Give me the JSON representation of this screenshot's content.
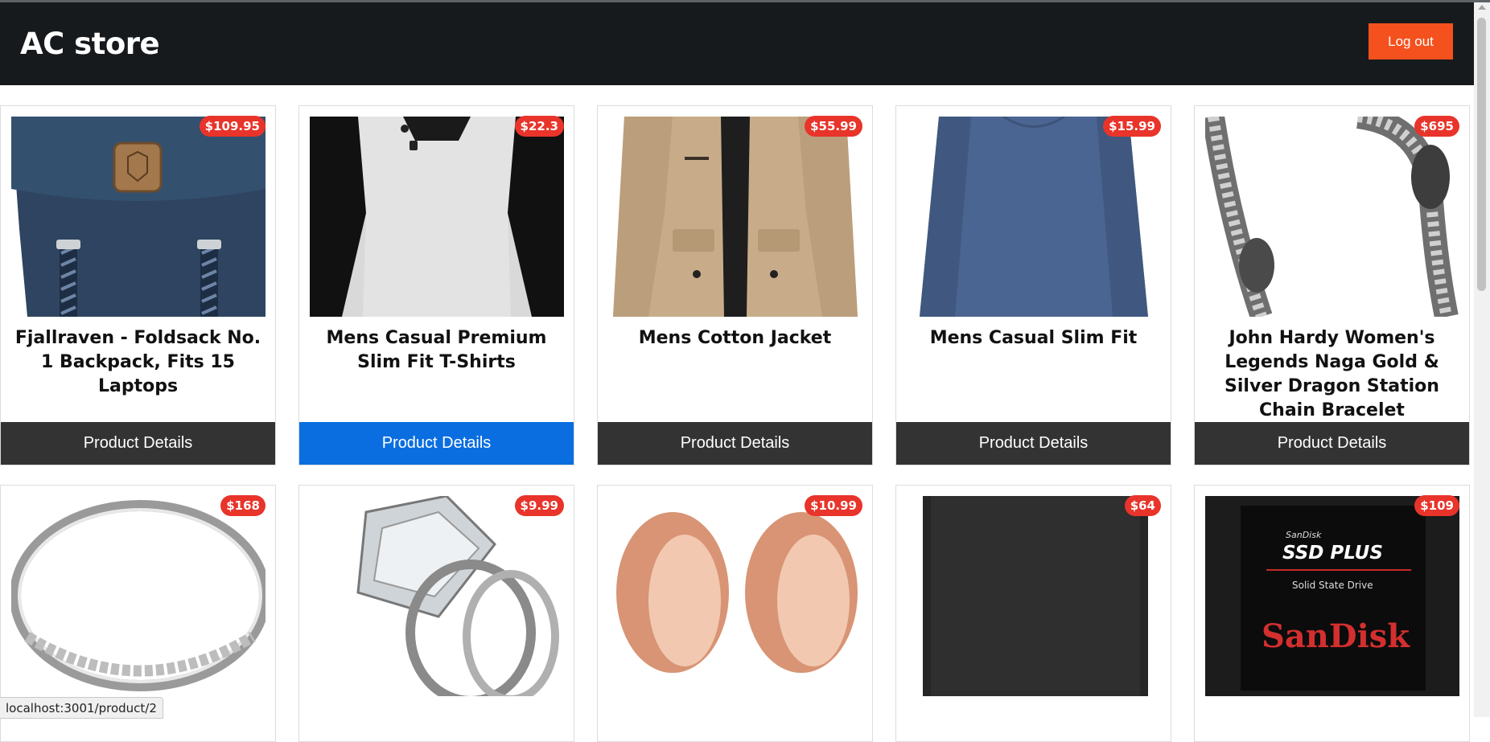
{
  "header": {
    "brand": "AC store",
    "logout_label": "Log out"
  },
  "products": [
    {
      "title": "Fjallraven - Foldsack No. 1 Backpack, Fits 15 Laptops",
      "price": "$109.95",
      "button": "Product Details",
      "image": "backpack-image"
    },
    {
      "title": "Mens Casual Premium Slim Fit T-Shirts",
      "price": "$22.3",
      "button": "Product Details",
      "image": "tshirt-image"
    },
    {
      "title": "Mens Cotton Jacket",
      "price": "$55.99",
      "button": "Product Details",
      "image": "jacket-image"
    },
    {
      "title": "Mens Casual Slim Fit",
      "price": "$15.99",
      "button": "Product Details",
      "image": "longsleeve-image"
    },
    {
      "title": "John Hardy Women's Legends Naga Gold & Silver Dragon Station Chain Bracelet",
      "price": "$695",
      "button": "Product Details",
      "image": "bracelet-image"
    },
    {
      "title": "",
      "price": "$168",
      "button": "",
      "image": "ring-band-image"
    },
    {
      "title": "",
      "price": "$9.99",
      "button": "",
      "image": "diamond-ring-image"
    },
    {
      "title": "",
      "price": "$10.99",
      "button": "",
      "image": "rose-gold-tunnels-image"
    },
    {
      "title": "",
      "price": "$64",
      "button": "",
      "image": "hard-drive-image"
    },
    {
      "title": "",
      "price": "$109",
      "button": "",
      "image": "ssd-image"
    }
  ],
  "ssd_label": {
    "line1": "SanDisk",
    "line2": "SSD PLUS",
    "line3": "Solid State Drive",
    "brand": "SanDisk"
  },
  "status_bar": {
    "url": "localhost:3001/product/2"
  },
  "colors": {
    "header_bg": "#171a1d",
    "accent": "#f4511e",
    "price_badge": "#e8342a",
    "button_bg": "#333333",
    "button_active": "#0a6ee0"
  }
}
